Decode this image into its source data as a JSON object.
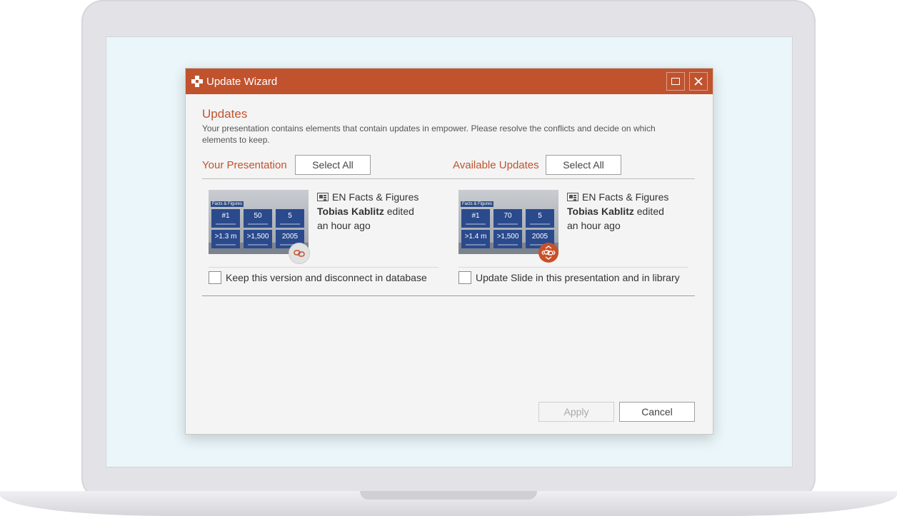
{
  "window": {
    "title": "Update Wizard"
  },
  "content": {
    "heading": "Updates",
    "description": "Your presentation contains elements that contain updates in empower. Please resolve the conflicts and decide on which elements to keep."
  },
  "left_column": {
    "heading": "Your Presentation",
    "select_all_label": "Select All",
    "item": {
      "doc_name": "EN Facts & Figures",
      "author": "Tobias Kablitz",
      "action": "edited",
      "time": "an hour ago",
      "checkbox_label": "Keep this version and disconnect in database",
      "checked": false,
      "thumbnail": {
        "tag": "Facts & Figures",
        "tiles": [
          "#1",
          "50",
          "5",
          ">1.3 m",
          ">1,500",
          "2005"
        ]
      },
      "badge_icon": "link-icon"
    }
  },
  "right_column": {
    "heading": "Available Updates",
    "select_all_label": "Select All",
    "item": {
      "doc_name": "EN Facts & Figures",
      "author": "Tobias Kablitz",
      "action": "edited",
      "time": "an hour ago",
      "checkbox_label": "Update Slide in this presentation and in library",
      "checked": false,
      "thumbnail": {
        "tag": "Facts & Figures",
        "tiles": [
          "#1",
          "70",
          "5",
          ">1.4 m",
          ">1,500",
          "2005"
        ]
      },
      "badge_icon": "sync-link-icon"
    }
  },
  "footer": {
    "apply_label": "Apply",
    "cancel_label": "Cancel",
    "apply_enabled": false
  },
  "colors": {
    "accent": "#c0532e",
    "screen_background": "#eaf6f9",
    "dialog_background": "#f4f4f4"
  }
}
